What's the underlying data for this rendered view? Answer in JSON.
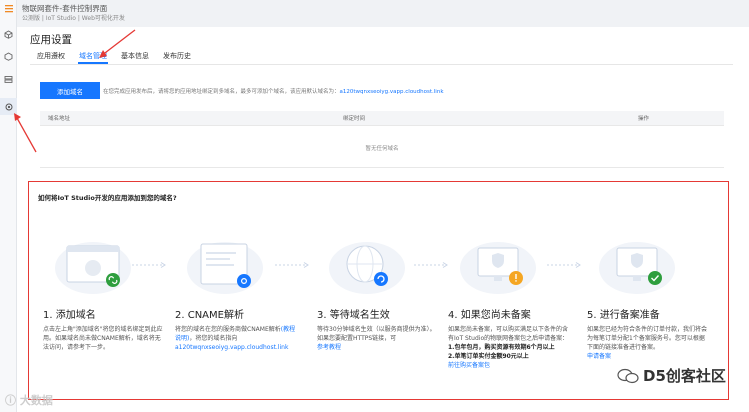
{
  "header": {
    "title": "物联网套件-套件控制界面",
    "breadcrumb": "公测版 | IoT Studio | Web可视化开发"
  },
  "page": {
    "title": "应用设置"
  },
  "tabs": [
    {
      "label": "应用遵权"
    },
    {
      "label": "域名管理"
    },
    {
      "label": "基本信息"
    },
    {
      "label": "发布历史"
    }
  ],
  "domain": {
    "add_button": "添加域名",
    "tip": "在您完成应用发布后，请将您的应用地址绑定到多域名，最多可添加个域名，该应用默认域名为：",
    "default_domain": "a120twqnxseoiyg.vapp.cloudhost.link"
  },
  "table": {
    "columns": [
      "域名地址",
      "绑定时间",
      "操作"
    ],
    "empty_text": "暂无任何域名"
  },
  "help": {
    "title": "如何将IoT Studio开发的应用添加到您的域名?",
    "steps": [
      {
        "heading": "1. 添加域名",
        "desc": "点击左上角\"添加域名\"将您的域名绑定到此应用。如果域名尚未做CNAME解析，域名将无法访问，请参考下一步。"
      },
      {
        "heading": "2. CNAME解析",
        "desc": "将您的域名在您的服务商做CNAME解析",
        "desc_link": "(教程说明)",
        "desc2": "，将您的域名指向",
        "link": "a120twqnxseoiyg.vapp.cloudhost.link"
      },
      {
        "heading": "3. 等待域名生效",
        "desc": "等待30分钟域名生效（以服务商提供为准）。如果您要配置HTTPS链接，可",
        "link": "参考教程"
      },
      {
        "heading": "4. 如果您尚未备案",
        "desc": "如果您尚未备案，可以购买满足以下条件的含有IoT Studio的物联网备案包之后申请备案：",
        "bold1": "1.包年包月，购买资源有效期6个月以上",
        "bold2": "2.单笔订单实付金额90元以上",
        "link": "前往购买备案包"
      },
      {
        "heading": "5. 进行备案准备",
        "desc": "如果您已经为符合条件的订单付款，我们将会为每笔订单分配1个备案服务号。您可以根据下面的链接准备进行备案。",
        "link": "申请备案"
      }
    ]
  },
  "watermark": {
    "left": "ⓘ 大数据",
    "right": "D5创客社区"
  },
  "colors": {
    "primary": "#1677ff",
    "annotation": "#e53935",
    "warning": "#f5a623",
    "success": "#2e9e3e"
  }
}
